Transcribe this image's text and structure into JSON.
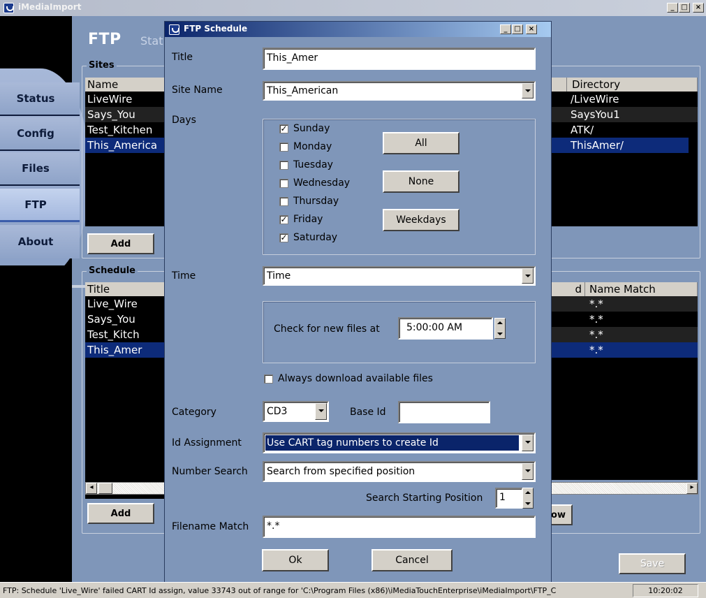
{
  "main_window": {
    "title": "iMediaImport",
    "heading": "FTP",
    "heading_sub": "Stat"
  },
  "nav": [
    "Status",
    "Config",
    "Files",
    "FTP",
    "About"
  ],
  "sites": {
    "label": "Sites",
    "col_name": "Name",
    "col_directory": "Directory",
    "rows": [
      {
        "name": "LiveWire",
        "dir": "/LiveWire"
      },
      {
        "name": "Says_You",
        "dir": "SaysYou1"
      },
      {
        "name": "Test_Kitchen",
        "dir": "ATK/"
      },
      {
        "name": "This_America",
        "dir": "ThisAmer/"
      }
    ],
    "add_label": "Add"
  },
  "schedule": {
    "label": "Schedule",
    "col_title": "Title",
    "col_d": "d",
    "col_name_match": "Name Match",
    "rows": [
      {
        "title": "Live_Wire",
        "match": "*.*"
      },
      {
        "title": "Says_You",
        "match": "*.*"
      },
      {
        "title": "Test_Kitch",
        "match": "*.*"
      },
      {
        "title": "This_Amer",
        "match": "*.*"
      }
    ],
    "add_label": "Add",
    "right_btn_fragment": "ow"
  },
  "save_label": "Save",
  "dialog": {
    "title": "FTP Schedule",
    "title_label": "Title",
    "title_value": "This_Amer",
    "site_label": "Site Name",
    "site_value": "This_American",
    "days_label": "Days",
    "days": [
      {
        "name": "Sunday",
        "checked": true
      },
      {
        "name": "Monday",
        "checked": false
      },
      {
        "name": "Tuesday",
        "checked": false
      },
      {
        "name": "Wednesday",
        "checked": false
      },
      {
        "name": "Thursday",
        "checked": false
      },
      {
        "name": "Friday",
        "checked": true
      },
      {
        "name": "Saturday",
        "checked": true
      }
    ],
    "all_label": "All",
    "none_label": "None",
    "weekdays_label": "Weekdays",
    "time_label": "Time",
    "time_value": "Time",
    "check_label": "Check for new files at",
    "check_value": "5:00:00 AM",
    "always_label": "Always download available files",
    "always_checked": false,
    "category_label": "Category",
    "category_value": "CD3",
    "base_id_label": "Base Id",
    "base_id_value": "",
    "id_assign_label": "Id Assignment",
    "id_assign_value": "Use CART tag numbers to create Id",
    "number_search_label": "Number Search",
    "number_search_value": "Search from specified position",
    "start_pos_label": "Search Starting Position",
    "start_pos_value": "1",
    "filename_label": "Filename Match",
    "filename_value": "*.*",
    "ok_label": "Ok",
    "cancel_label": "Cancel"
  },
  "status": {
    "message": "FTP: Schedule 'Live_Wire' failed CART Id assign, value 33743 out of range for 'C:\\Program Files (x86)\\iMediaTouchEnterprise\\iMediaImport\\FTP_C",
    "time": "10:20:02"
  }
}
